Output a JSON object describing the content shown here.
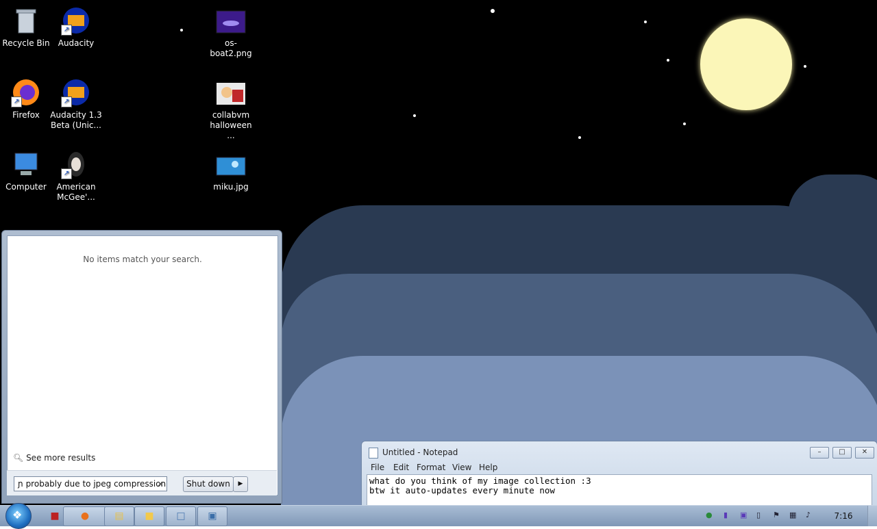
{
  "desktop": {
    "icons": [
      {
        "label": "Recycle Bin",
        "icon": "recycle-bin-icon"
      },
      {
        "label": "Audacity",
        "icon": "audacity-icon"
      },
      {
        "label": "os-boat2.png",
        "icon": "image-file-icon"
      },
      {
        "label": "Firefox",
        "icon": "firefox-icon"
      },
      {
        "label": "Audacity 1.3 Beta (Unic...",
        "icon": "audacity-icon"
      },
      {
        "label": "collabvm halloween ...",
        "icon": "image-file-icon"
      },
      {
        "label": "Computer",
        "icon": "computer-icon"
      },
      {
        "label": "American McGee'...",
        "icon": "game-icon"
      },
      {
        "label": "miku.jpg",
        "icon": "image-file-icon"
      }
    ]
  },
  "start_menu": {
    "no_results": "No items match your search.",
    "see_more": "See more results",
    "search_value": "ɲ probably due to jpeg compression",
    "clear_glyph": "×",
    "shutdown_label": "Shut down",
    "shutdown_arrow": "▶"
  },
  "notepad": {
    "title": "Untitled - Notepad",
    "menu": [
      "File",
      "Edit",
      "Format",
      "View",
      "Help"
    ],
    "lines": [
      "what do you think of my image collection :3",
      "btw it auto-updates every minute now"
    ],
    "buttons": {
      "minimize": "–",
      "maximize": "□",
      "close": "✕"
    }
  },
  "taskbar": {
    "clock": "7:16",
    "pinned": [
      "program-icon",
      "firefox-icon",
      "explorer-icon",
      "folder-icon",
      "notepad-icon",
      "remote-icon"
    ]
  },
  "colors": {
    "sky": "#000000",
    "moon": "#fbf6b8",
    "cloud_dark": "#2a3a52",
    "cloud_mid": "#4a5f7f",
    "cloud_light": "#7b92b8"
  }
}
